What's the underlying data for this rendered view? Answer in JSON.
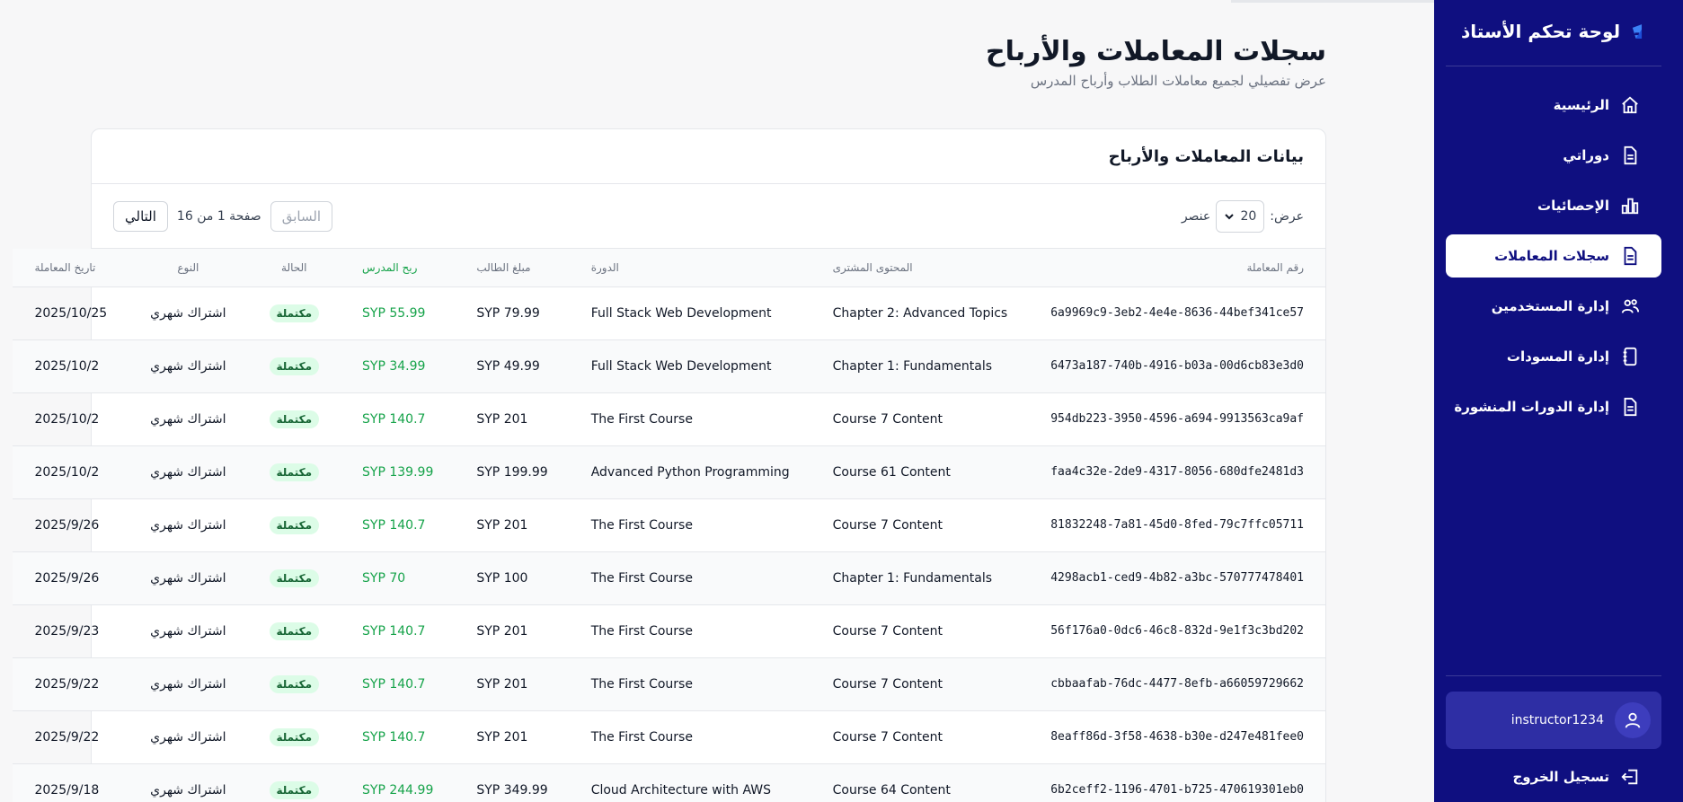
{
  "sidebar": {
    "brand_title": "لوحة تحكم الأستاذ",
    "nav": [
      {
        "label": "الرئيسية",
        "icon": "home-icon"
      },
      {
        "label": "دوراتي",
        "icon": "document-icon"
      },
      {
        "label": "الإحصائيات",
        "icon": "bar-chart-icon"
      },
      {
        "label": "سجلات المعاملات",
        "icon": "document-icon",
        "active": true
      },
      {
        "label": "إدارة المستخدمين",
        "icon": "users-icon"
      },
      {
        "label": "إدارة المسودات",
        "icon": "notebook-icon"
      },
      {
        "label": "إدارة الدورات المنشورة",
        "icon": "document-icon"
      }
    ],
    "user_name": "instructor1234",
    "logout_label": "تسجيل الخروج"
  },
  "header": {
    "title": "سجلات المعاملات والأرباح",
    "subtitle": "عرض تفصيلي لجميع معاملات الطلاب وأرباح المدرس"
  },
  "card": {
    "title": "بيانات المعاملات والأرباح",
    "show_label": "عرض:",
    "per_page": "20",
    "items_label": "عنصر",
    "prev_label": "السابق",
    "next_label": "التالي",
    "page_info": "صفحة 1 من 16"
  },
  "table": {
    "headers": {
      "id": "رقم المعاملة",
      "content": "المحتوى المشترى",
      "course": "الدورة",
      "amount": "مبلغ الطالب",
      "profit": "ربح المدرس",
      "status": "الحالة",
      "type": "النوع",
      "date": "تاريخ المعاملة"
    },
    "rows": [
      {
        "id": "6a9969c9-3eb2-4e4e-8636-44bef341ce57",
        "content": "Chapter 2: Advanced Topics",
        "course": "Full Stack Web Development",
        "amount": "SYP 79.99",
        "profit": "SYP 55.99",
        "status": "مكتملة",
        "type": "اشتراك شهري",
        "date": "2025/10/25"
      },
      {
        "id": "6473a187-740b-4916-b03a-00d6cb83e3d0",
        "content": "Chapter 1: Fundamentals",
        "course": "Full Stack Web Development",
        "amount": "SYP 49.99",
        "profit": "SYP 34.99",
        "status": "مكتملة",
        "type": "اشتراك شهري",
        "date": "2025/10/2"
      },
      {
        "id": "954db223-3950-4596-a694-9913563ca9af",
        "content": "Course 7 Content",
        "course": "The First Course",
        "amount": "SYP 201",
        "profit": "SYP 140.7",
        "status": "مكتملة",
        "type": "اشتراك شهري",
        "date": "2025/10/2"
      },
      {
        "id": "faa4c32e-2de9-4317-8056-680dfe2481d3",
        "content": "Course 61 Content",
        "course": "Advanced Python Programming",
        "amount": "SYP 199.99",
        "profit": "SYP 139.99",
        "status": "مكتملة",
        "type": "اشتراك شهري",
        "date": "2025/10/2"
      },
      {
        "id": "81832248-7a81-45d0-8fed-79c7ffc05711",
        "content": "Course 7 Content",
        "course": "The First Course",
        "amount": "SYP 201",
        "profit": "SYP 140.7",
        "status": "مكتملة",
        "type": "اشتراك شهري",
        "date": "2025/9/26"
      },
      {
        "id": "4298acb1-ced9-4b82-a3bc-570777478401",
        "content": "Chapter 1: Fundamentals",
        "course": "The First Course",
        "amount": "SYP 100",
        "profit": "SYP 70",
        "status": "مكتملة",
        "type": "اشتراك شهري",
        "date": "2025/9/26"
      },
      {
        "id": "56f176a0-0dc6-46c8-832d-9e1f3c3bd202",
        "content": "Course 7 Content",
        "course": "The First Course",
        "amount": "SYP 201",
        "profit": "SYP 140.7",
        "status": "مكتملة",
        "type": "اشتراك شهري",
        "date": "2025/9/23"
      },
      {
        "id": "cbbaafab-76dc-4477-8efb-a66059729662",
        "content": "Course 7 Content",
        "course": "The First Course",
        "amount": "SYP 201",
        "profit": "SYP 140.7",
        "status": "مكتملة",
        "type": "اشتراك شهري",
        "date": "2025/9/22"
      },
      {
        "id": "8eaff86d-3f58-4638-b30e-d247e481fee0",
        "content": "Course 7 Content",
        "course": "The First Course",
        "amount": "SYP 201",
        "profit": "SYP 140.7",
        "status": "مكتملة",
        "type": "اشتراك شهري",
        "date": "2025/9/22"
      },
      {
        "id": "6b2ceff2-1196-4701-b725-470619301eb0",
        "content": "Course 64 Content",
        "course": "Cloud Architecture with AWS",
        "amount": "SYP 349.99",
        "profit": "SYP 244.99",
        "status": "مكتملة",
        "type": "اشتراك شهري",
        "date": "2025/9/18"
      }
    ]
  },
  "colors": {
    "sidebar_bg": "#0f0f80",
    "profit_green": "#16a34a",
    "badge_bg": "#dcfce7",
    "badge_text": "#166534"
  }
}
